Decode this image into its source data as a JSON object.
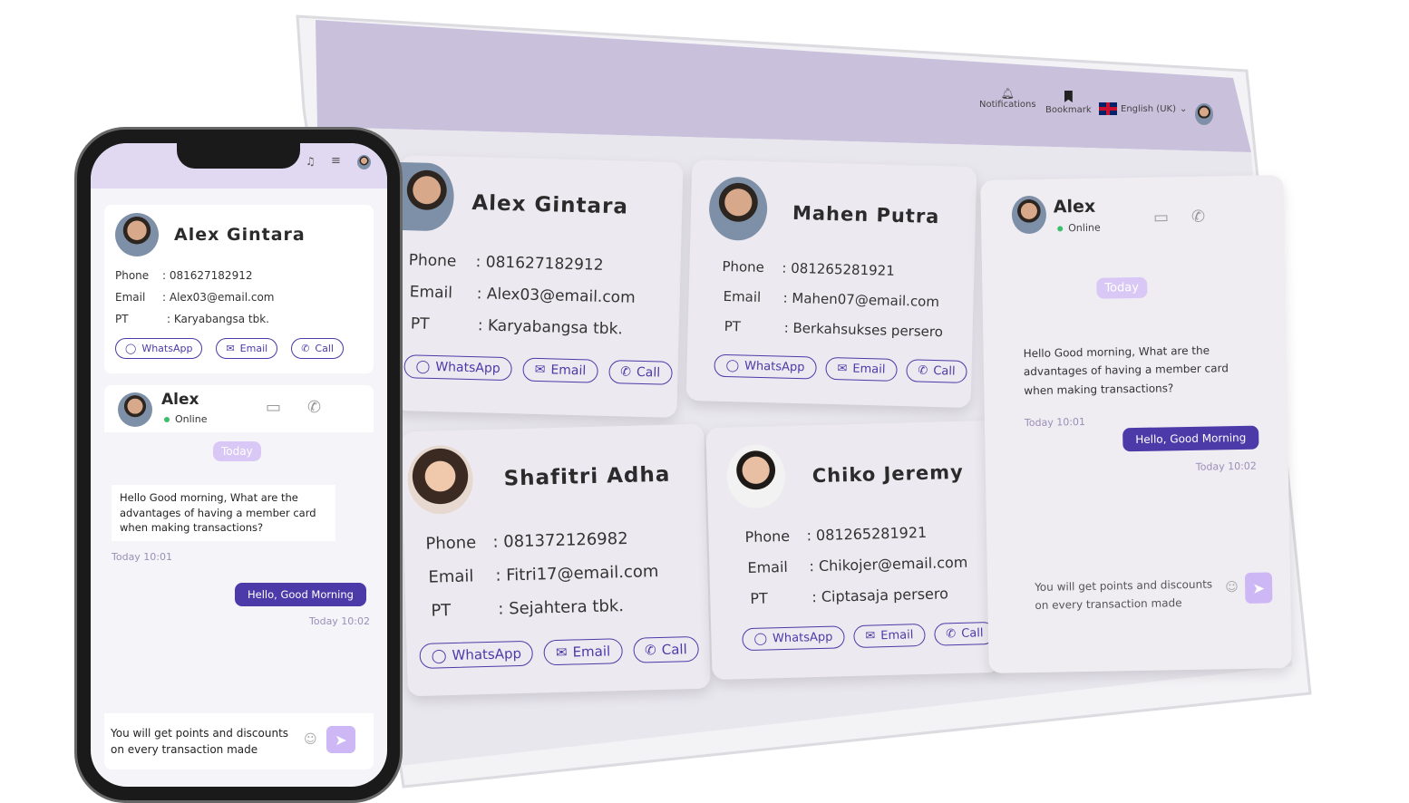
{
  "tablet": {
    "header": {
      "notifications": "Notifications",
      "bookmark": "Bookmark",
      "language": "English (UK)"
    },
    "contacts": [
      {
        "name": "Alex Gintara",
        "phone": ": 081627182912",
        "email": ": Alex03@email.com",
        "pt": ": Karyabangsa tbk."
      },
      {
        "name": "Mahen Putra",
        "phone": ": 081265281921",
        "email": ": Mahen07@email.com",
        "pt": ": Berkahsukses persero"
      },
      {
        "name": "Shafitri Adha",
        "phone": ": 081372126982",
        "email": ": Fitri17@email.com",
        "pt": ": Sejahtera tbk."
      },
      {
        "name": "Chiko Jeremy",
        "phone": ": 081265281921",
        "email": ": Chikojer@email.com",
        "pt": ": Ciptasaja persero"
      }
    ],
    "labels": {
      "phone": "Phone",
      "email": "Email",
      "pt": "PT",
      "whatsapp": "WhatsApp",
      "email_btn": "Email",
      "call": "Call"
    },
    "chat": {
      "name": "Alex",
      "status": "Online",
      "today": "Today",
      "incoming": "Hello Good morning, What are the advantages of having a member card when making transactions?",
      "incoming_time": "Today 10:01",
      "outgoing": "Hello, Good Morning",
      "outgoing_time": "Today 10:02",
      "input": "You will get points and discounts on every transaction made"
    }
  },
  "phone": {
    "contact": {
      "name": "Alex Gintara",
      "phone": ": 081627182912",
      "email": ": Alex03@email.com",
      "pt": ": Karyabangsa tbk."
    },
    "chat": {
      "name": "Alex",
      "status": "Online",
      "today": "Today",
      "incoming": "Hello Good morning, What are the advantages of having a member card when making transactions?",
      "incoming_time": "Today 10:01",
      "outgoing": "Hello, Good Morning",
      "outgoing_time": "Today 10:02",
      "input": "You will get points and discounts on every transaction made"
    }
  },
  "colors": {
    "accent": "#4b3aa8",
    "header": "#c9c0dc",
    "today_pill": "#d9c8f5",
    "online": "#3bbf6b"
  }
}
